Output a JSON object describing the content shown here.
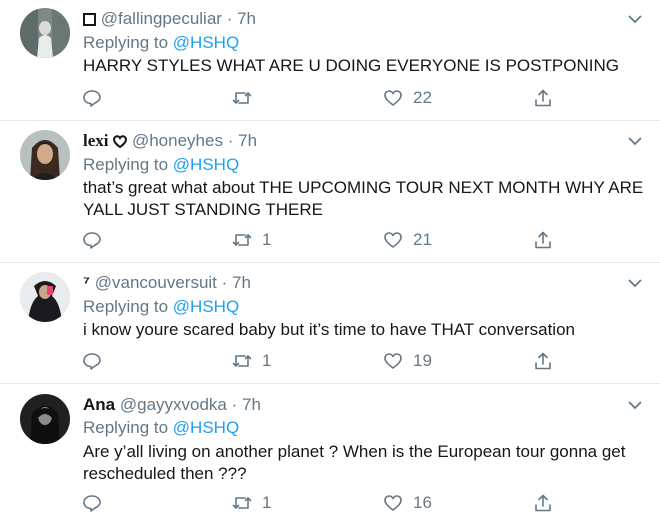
{
  "tweets": [
    {
      "name": "",
      "name_prefix_icon": "square-outline-icon",
      "handle": "@fallingpeculiar",
      "separator": "·",
      "time": "7h",
      "replying_prefix": "Replying to",
      "replying_to": "@HSHQ",
      "text_lines": [
        "HARRY STYLES WHAT ARE U DOING EVERYONE IS POSTPONING"
      ],
      "retweets": "",
      "likes": "22"
    },
    {
      "name": "lexi",
      "name_suffix_icon": "heart-outline-icon",
      "handle": "@honeyhes",
      "separator": "·",
      "time": "7h",
      "replying_prefix": "Replying to",
      "replying_to": "@HSHQ",
      "text_lines": [
        "that’s great what about THE UPCOMING TOUR NEXT MONTH WHY ARE",
        "YALL JUST STANDING THERE"
      ],
      "retweets": "1",
      "likes": "21"
    },
    {
      "name": "⁷",
      "handle": "@vancouversuit",
      "separator": "·",
      "time": "7h",
      "replying_prefix": "Replying to",
      "replying_to": "@HSHQ",
      "text_lines": [
        "i know youre scared baby but it’s time to have THAT conversation"
      ],
      "retweets": "1",
      "likes": "19"
    },
    {
      "name": "Ana",
      "handle": "@gayyxvodka",
      "separator": "·",
      "time": "7h",
      "replying_prefix": "Replying to",
      "replying_to": "@HSHQ",
      "text_lines": [
        "Are y’all living on another planet ? When is the European tour gonna get",
        "rescheduled then ???"
      ],
      "retweets": "1",
      "likes": "16"
    }
  ],
  "colors": {
    "text": "#14171a",
    "muted": "#657786",
    "link": "#1da1f2",
    "divider": "#e6ecf0"
  },
  "icons": {
    "reply": "reply-icon",
    "retweet": "retweet-icon",
    "like": "heart-icon",
    "share": "share-icon",
    "more": "chevron-down-icon"
  }
}
